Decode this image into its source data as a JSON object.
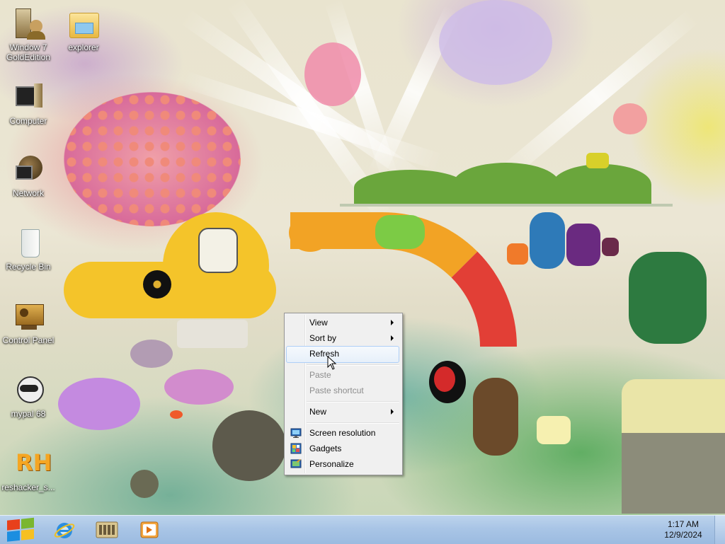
{
  "desktop_icons": [
    {
      "name": "window7-goldedition",
      "label_line1": "Window 7",
      "label_line2": "GoldEdition",
      "icon": "person-pc-icon"
    },
    {
      "name": "explorer",
      "label_line1": "explorer",
      "label_line2": "",
      "icon": "folder-icon"
    },
    {
      "name": "computer",
      "label_line1": "Computer",
      "label_line2": "",
      "icon": "computer-icon"
    },
    {
      "name": "network",
      "label_line1": "Network",
      "label_line2": "",
      "icon": "network-icon"
    },
    {
      "name": "recycle-bin",
      "label_line1": "Recycle Bin",
      "label_line2": "",
      "icon": "recycle-bin-icon"
    },
    {
      "name": "control-panel",
      "label_line1": "Control Panel",
      "label_line2": "",
      "icon": "control-panel-icon"
    },
    {
      "name": "mypal-68",
      "label_line1": "mypal 68",
      "label_line2": "",
      "icon": "raccoon-icon"
    },
    {
      "name": "reshacker",
      "label_line1": "reshacker_s...",
      "label_line2": "",
      "icon": "rh-icon"
    }
  ],
  "context_menu": {
    "items": [
      {
        "label": "View",
        "submenu": true,
        "disabled": false
      },
      {
        "label": "Sort by",
        "submenu": true,
        "disabled": false
      },
      {
        "label": "Refresh",
        "submenu": false,
        "disabled": false,
        "highlighted": true
      },
      {
        "label": "Paste",
        "submenu": false,
        "disabled": true
      },
      {
        "label": "Paste shortcut",
        "submenu": false,
        "disabled": true
      },
      {
        "label": "New",
        "submenu": true,
        "disabled": false
      },
      {
        "label": "Screen resolution",
        "submenu": false,
        "disabled": false,
        "icon": "monitor-icon"
      },
      {
        "label": "Gadgets",
        "submenu": false,
        "disabled": false,
        "icon": "gadgets-icon"
      },
      {
        "label": "Personalize",
        "submenu": false,
        "disabled": false,
        "icon": "personalize-icon"
      }
    ]
  },
  "taskbar": {
    "start_icon": "windows-logo-icon",
    "pinned": [
      {
        "name": "internet-explorer",
        "icon": "ie-icon"
      },
      {
        "name": "file-explorer",
        "icon": "library-folder-icon"
      },
      {
        "name": "media-player",
        "icon": "media-player-icon"
      }
    ],
    "clock": {
      "time": "1:17 AM",
      "date": "12/9/2024"
    }
  },
  "colors": {
    "taskbar": "#a9c5e6",
    "menu_bg": "#f0f0f0",
    "highlight_border": "#aecff7"
  }
}
